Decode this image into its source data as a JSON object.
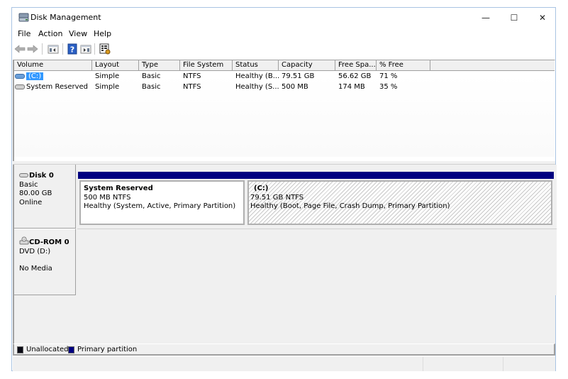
{
  "window": {
    "title": "Disk Management",
    "controls": {
      "minimize": "—",
      "maximize": "☐",
      "close": "✕"
    }
  },
  "menubar": [
    "File",
    "Action",
    "View",
    "Help"
  ],
  "toolbar": {
    "buttons": [
      "back-icon",
      "forward-icon",
      "console-tree-icon",
      "help-icon",
      "action-pane-icon",
      "properties-icon"
    ]
  },
  "volume_list": {
    "columns": [
      "Volume",
      "Layout",
      "Type",
      "File System",
      "Status",
      "Capacity",
      "Free Spa...",
      "% Free"
    ],
    "rows": [
      {
        "volume": "(C:)",
        "layout": "Simple",
        "type": "Basic",
        "fs": "NTFS",
        "status": "Healthy (B...",
        "capacity": "79.51 GB",
        "free": "56.62 GB",
        "pct_free": "71 %",
        "selected": true
      },
      {
        "volume": "System Reserved",
        "layout": "Simple",
        "type": "Basic",
        "fs": "NTFS",
        "status": "Healthy (S...",
        "capacity": "500 MB",
        "free": "174 MB",
        "pct_free": "35 %",
        "selected": false
      }
    ]
  },
  "disks": [
    {
      "name": "Disk 0",
      "type": "Basic",
      "size": "80.00 GB",
      "state": "Online",
      "partitions": [
        {
          "name": "System Reserved",
          "size_fs": "500 MB NTFS",
          "status": "Healthy (System, Active, Primary Partition)"
        },
        {
          "name": "(C:)",
          "size_fs": "79.51 GB NTFS",
          "status": "Healthy (Boot, Page File, Crash Dump, Primary Partition)"
        }
      ]
    },
    {
      "name": "CD-ROM 0",
      "type": "DVD (D:)",
      "media": "No Media"
    }
  ],
  "legend": [
    {
      "label": "Unallocated",
      "color": "#0a0a14"
    },
    {
      "label": "Primary partition",
      "color": "#000080"
    }
  ],
  "colors": {
    "primary_partition_bar": "#000080",
    "selection": "#3399ff"
  }
}
